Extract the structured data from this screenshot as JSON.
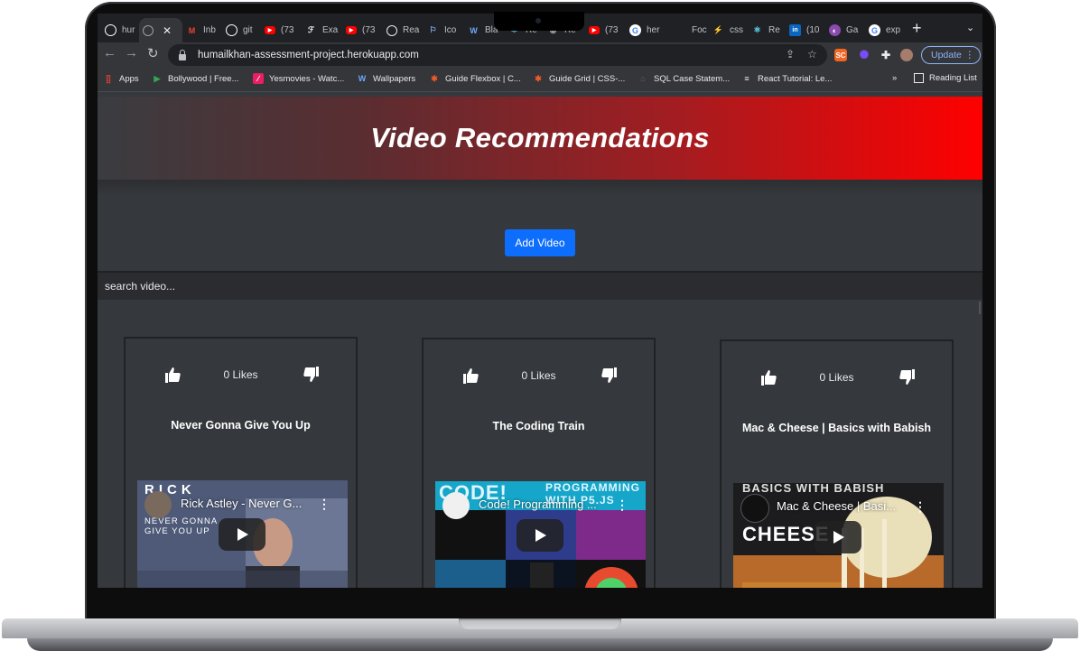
{
  "browser": {
    "tabs": [
      {
        "label": "hur",
        "icon": "github-icon",
        "color": "#ffffff",
        "active": false
      },
      {
        "label": "",
        "icon": "globe-icon",
        "color": "#9aa0a6",
        "active": true
      },
      {
        "label": "Inb",
        "icon": "gmail-icon",
        "color": "#ea4335",
        "active": false
      },
      {
        "label": "git",
        "icon": "github-icon",
        "color": "#ffffff",
        "active": false
      },
      {
        "label": "(73",
        "icon": "youtube-icon",
        "color": "#ff0000",
        "active": false
      },
      {
        "label": "Exa",
        "icon": "exa-icon",
        "color": "#ffffff",
        "active": false
      },
      {
        "label": "(73",
        "icon": "youtube-icon",
        "color": "#ff0000",
        "active": false
      },
      {
        "label": "Rea",
        "icon": "globe-icon",
        "color": "#ffffff",
        "active": false
      },
      {
        "label": "Ico",
        "icon": "flag-icon",
        "color": "#8ab4f8",
        "active": false
      },
      {
        "label": "Bla",
        "icon": "w-icon",
        "color": "#6ea8fe",
        "active": false
      },
      {
        "label": "Re",
        "icon": "react-icon",
        "color": "#61dafb",
        "active": false
      },
      {
        "label": "Re",
        "icon": "react-icon",
        "color": "#9aa0a6",
        "active": false
      },
      {
        "label": "(73",
        "icon": "youtube-icon",
        "color": "#ff0000",
        "active": false
      },
      {
        "label": "her",
        "icon": "google-icon",
        "color": "#4285f4",
        "active": false
      },
      {
        "label": "Foc",
        "icon": "doc-icon",
        "color": "#9aa0a6",
        "active": false
      },
      {
        "label": "css",
        "icon": "css-icon",
        "color": "#f29111",
        "active": false
      },
      {
        "label": "Re",
        "icon": "react-icon",
        "color": "#61dafb",
        "active": false
      },
      {
        "label": "(10",
        "icon": "linkedin-icon",
        "color": "#0a66c2",
        "active": false
      },
      {
        "label": "Ga",
        "icon": "gatsby-icon",
        "color": "#8a4baf",
        "active": false
      },
      {
        "label": "exp",
        "icon": "google-icon",
        "color": "#4285f4",
        "active": false
      }
    ],
    "url": "humailkhan-assessment-project.herokuapp.com",
    "update_label": "Update",
    "bookmarks": [
      {
        "label": "Apps",
        "icon": "apps-grid-icon"
      },
      {
        "label": "Bollywood | Free...",
        "icon": "play-store-icon"
      },
      {
        "label": "Yesmovies - Watc...",
        "icon": "yesmovies-icon"
      },
      {
        "label": "Wallpapers",
        "icon": "w-icon"
      },
      {
        "label": "Guide Flexbox | C...",
        "icon": "css-tricks-icon"
      },
      {
        "label": "Guide Grid | CSS-...",
        "icon": "css-tricks-icon"
      },
      {
        "label": "SQL Case Statem...",
        "icon": "sql-icon"
      },
      {
        "label": "React Tutorial: Le...",
        "icon": "react-tutorial-icon"
      }
    ],
    "more_bookmarks": "»",
    "reading_list": "Reading List"
  },
  "page": {
    "title": "Video Recommendations",
    "add_video_label": "Add Video",
    "search_placeholder": "search video...",
    "videos": [
      {
        "title": "Never Gonna Give You Up",
        "likes": "0 Likes",
        "embed_title": "Rick Astley - Never G...",
        "thumb_caption_1": "NEVER GONNA",
        "thumb_caption_2": "GIVE YOU UP",
        "thumb_big": "RICK"
      },
      {
        "title": "The Coding Train",
        "likes": "0 Likes",
        "embed_title": "Code! Programming ...",
        "thumb_caption_1": "PROGRAMMING",
        "thumb_caption_2": "WITH P5.JS",
        "thumb_big": "CODE!"
      },
      {
        "title": "Mac & Cheese | Basics with Babish",
        "likes": "0 Likes",
        "embed_title": "Mac & Cheese | Basi...",
        "thumb_caption_1": "BASICS WITH BABISH",
        "thumb_caption_2": "",
        "thumb_big": "CHEESE"
      }
    ]
  },
  "colors": {
    "accent_button": "#0d6efd",
    "hero_end": "#ff0000",
    "update_border": "#8ab4f8"
  }
}
